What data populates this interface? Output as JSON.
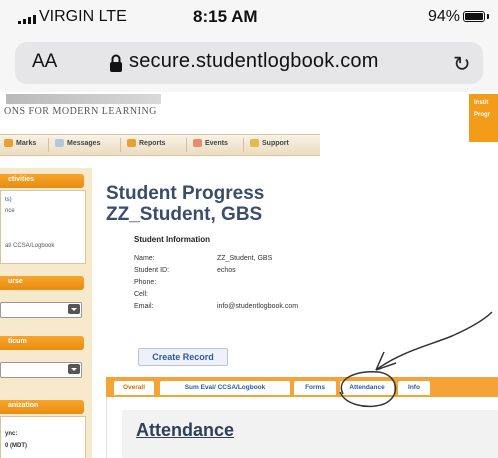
{
  "status_bar": {
    "carrier": "VIRGIN",
    "network": "LTE",
    "time": "8:15 AM",
    "battery": "94%"
  },
  "address_bar": {
    "text_size_label": "AA",
    "url": "secure.studentlogbook.com",
    "lock_icon": "lock-icon",
    "reload_icon": "reload-icon"
  },
  "site": {
    "tagline": "ONS FOR MODERN LEARNING",
    "header_right": [
      "Instit",
      "Progr"
    ],
    "nav": [
      {
        "label": "Marks",
        "icon": "check-icon"
      },
      {
        "label": "Messages",
        "icon": "mail-icon"
      },
      {
        "label": "Reports",
        "icon": "report-icon"
      },
      {
        "label": "Events",
        "icon": "calendar-icon"
      },
      {
        "label": "Support",
        "icon": "support-icon"
      }
    ]
  },
  "sidebar": {
    "activities_header": "ctivities",
    "activity_link": "ts)",
    "activity_text": "nce",
    "logbook_text": "al/ CCSA/Logbook",
    "course_header": "urse",
    "practicum_header": "ticum",
    "organization_header": "anization",
    "sync_label": "ync:",
    "sync_value": "0 (MDT)"
  },
  "main": {
    "title_line1": "Student Progress",
    "title_line2": "ZZ_Student, GBS",
    "info_header": "Student Information",
    "fields": [
      {
        "label": "Name:",
        "value": "ZZ_Student, GBS"
      },
      {
        "label": "Student ID:",
        "value": "echos"
      },
      {
        "label": "Phone:",
        "value": ""
      },
      {
        "label": "Cell:",
        "value": ""
      },
      {
        "label": "Email:",
        "value": "info@studentlogbook.com"
      }
    ],
    "create_record": "Create Record",
    "tabs": [
      "Overall",
      "Sum Eval/ CCSA/Logbook",
      "Forms",
      "Attendance",
      "Info"
    ],
    "active_tab": "Overall",
    "section_title": "Attendance"
  },
  "colors": {
    "accent_orange": "#f29c1a",
    "title_blue": "#3a4e6a",
    "link_blue": "#2a5aa8"
  }
}
